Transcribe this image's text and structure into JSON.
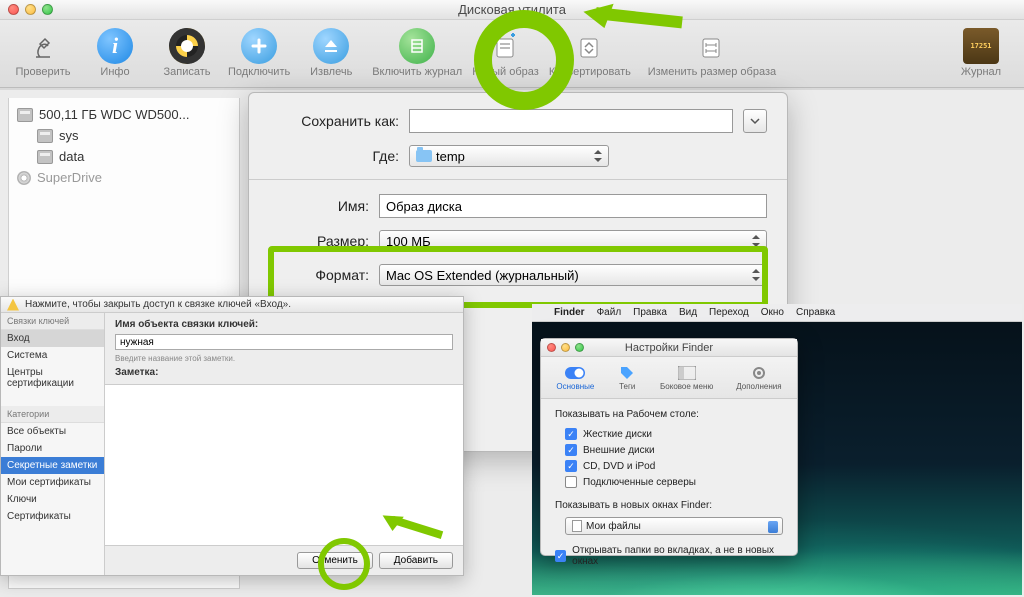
{
  "diskUtil": {
    "title": "Дисковая утилита",
    "toolbar": [
      {
        "label": "Проверить"
      },
      {
        "label": "Инфо"
      },
      {
        "label": "Записать"
      },
      {
        "label": "Подключить"
      },
      {
        "label": "Извлечь"
      },
      {
        "label": "Включить журнал"
      },
      {
        "label": "Новый образ"
      },
      {
        "label": "Конвертировать"
      },
      {
        "label": "Изменить размер образа"
      },
      {
        "label": "Журнал"
      }
    ],
    "sidebar": {
      "disk": "500,11 ГБ WDC WD500...",
      "vols": [
        "sys",
        "data"
      ],
      "optical": "SuperDrive"
    },
    "sheet": {
      "saveAsLabel": "Сохранить как:",
      "saveAsValue": "",
      "whereLabel": "Где:",
      "whereValue": "temp",
      "nameLabel": "Имя:",
      "nameValue": "Образ диска",
      "sizeLabel": "Размер:",
      "sizeValue": "100 МБ",
      "formatLabel": "Формат:",
      "formatValue": "Mac OS Extended (журнальный)"
    }
  },
  "keychain": {
    "hint": "Нажмите, чтобы закрыть доступ к связке ключей «Вход».",
    "leftTitle1": "Связки ключей",
    "chains": [
      "Вход",
      "Система",
      "Центры сертификации"
    ],
    "leftTitle2": "Категории",
    "cats": [
      "Все объекты",
      "Пароли",
      "Секретные заметки",
      "Мои сертификаты",
      "Ключи",
      "Сертификаты"
    ],
    "form": {
      "nameLabel": "Имя объекта связки ключей:",
      "nameValue": "нужная",
      "nameHint": "Введите название этой заметки.",
      "noteLabel": "Заметка:"
    },
    "btnCancel": "Отменить",
    "btnAdd": "Добавить"
  },
  "desktop": {
    "menu": [
      "Finder",
      "Файл",
      "Правка",
      "Вид",
      "Переход",
      "Окно",
      "Справка"
    ],
    "finder": {
      "title": "Настройки Finder",
      "tabs": [
        "Основные",
        "Теги",
        "Боковое меню",
        "Дополнения"
      ],
      "h1": "Показывать на Рабочем столе:",
      "checks": [
        {
          "label": "Жесткие диски",
          "on": true
        },
        {
          "label": "Внешние диски",
          "on": true
        },
        {
          "label": "CD, DVD и iPod",
          "on": true
        },
        {
          "label": "Подключенные серверы",
          "on": false
        }
      ],
      "h2": "Показывать в новых окнах Finder:",
      "sel": "Мои файлы",
      "tabsOpt": {
        "label": "Открывать папки во вкладках, а не в новых окнах",
        "on": true
      }
    }
  }
}
